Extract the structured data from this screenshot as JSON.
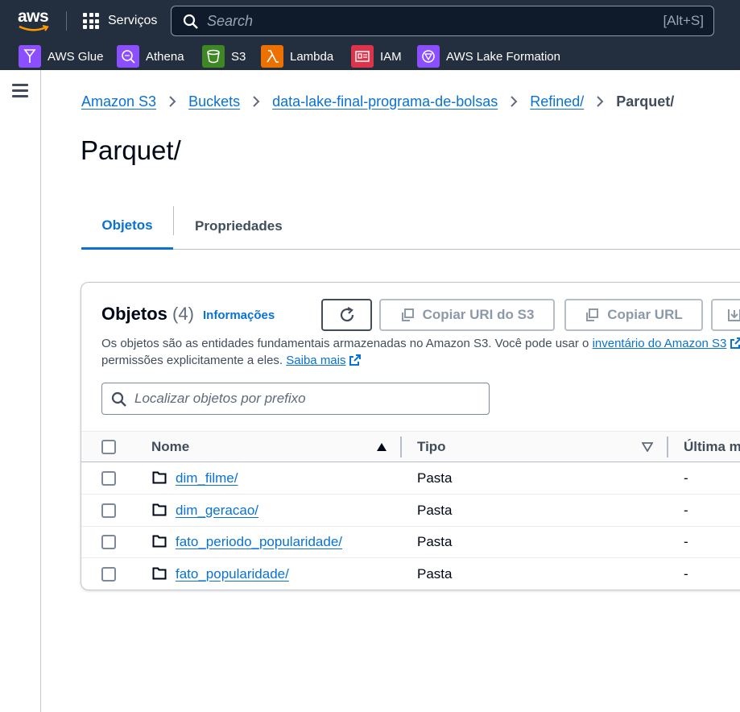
{
  "topnav": {
    "logo": "aws",
    "services_label": "Serviços",
    "search_placeholder": "Search",
    "search_shortcut": "[Alt+S]"
  },
  "favorites": [
    {
      "label": "AWS Glue",
      "icon": "glue-icon",
      "color": "#8c4fff"
    },
    {
      "label": "Athena",
      "icon": "athena-icon",
      "color": "#8c4fff"
    },
    {
      "label": "S3",
      "icon": "s3-bucket-icon",
      "color": "#3f8624"
    },
    {
      "label": "Lambda",
      "icon": "lambda-icon",
      "color": "#ed7100"
    },
    {
      "label": "IAM",
      "icon": "iam-icon",
      "color": "#dd344c"
    },
    {
      "label": "AWS Lake Formation",
      "icon": "lake-formation-icon",
      "color": "#8c4fff"
    }
  ],
  "breadcrumb": {
    "items": [
      "Amazon S3",
      "Buckets",
      "data-lake-final-programa-de-bolsas",
      "Refined/"
    ],
    "current": "Parquet/"
  },
  "page_title": "Parquet/",
  "tabs": {
    "active": "Objetos",
    "other": "Propriedades"
  },
  "objects_panel": {
    "title": "Objetos",
    "count": "(4)",
    "info_link": "Informações",
    "buttons": {
      "copy_uri": "Copiar URI do S3",
      "copy_url": "Copiar URL"
    },
    "description_line1": "Os objetos são as entidades fundamentais armazenadas no Amazon S3. Você pode usar o",
    "inventory_link": "inventário do Amazon S3",
    "description_line2": "permissões explicitamente a eles.",
    "learn_more": "Saiba mais",
    "filter_placeholder": "Localizar objetos por prefixo"
  },
  "table": {
    "columns": [
      "Nome",
      "Tipo",
      "Última m"
    ],
    "rows": [
      {
        "name": "dim_filme/",
        "type": "Pasta",
        "modified": "-"
      },
      {
        "name": "dim_geracao/",
        "type": "Pasta",
        "modified": "-"
      },
      {
        "name": "fato_periodo_popularidade/",
        "type": "Pasta",
        "modified": "-"
      },
      {
        "name": "fato_popularidade/",
        "type": "Pasta",
        "modified": "-"
      }
    ]
  },
  "colors": {
    "nav_bg": "#232f3e",
    "link": "#0972d3",
    "text": "#16191f"
  }
}
